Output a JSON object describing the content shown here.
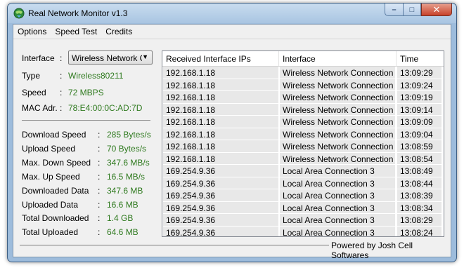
{
  "window": {
    "title": "Real Network Monitor v1.3"
  },
  "caption": {
    "minimize": "–",
    "maximize": "□",
    "close": "✕"
  },
  "menu": [
    "Options",
    "Speed Test",
    "Credits"
  ],
  "info": {
    "interface_label": "Interface",
    "interface_value": "Wireless Network Co",
    "type_label": "Type",
    "type_value": "Wireless80211",
    "speed_label": "Speed",
    "speed_value": "72 MBPS",
    "mac_label": "MAC Adr.",
    "mac_value": "78:E4:00:0C:AD:7D"
  },
  "stats": [
    {
      "label": "Download Speed",
      "value": "285 Bytes/s"
    },
    {
      "label": "Upload Speed",
      "value": "70 Bytes/s"
    },
    {
      "label": "Max. Down Speed",
      "value": "347.6 MB/s"
    },
    {
      "label": "Max. Up Speed",
      "value": "16.5 MB/s"
    },
    {
      "label": "Downloaded Data",
      "value": "347.6 MB"
    },
    {
      "label": "Uploaded Data",
      "value": "16.6 MB"
    },
    {
      "label": "Total Downloaded",
      "value": "1.4 GB"
    },
    {
      "label": "Total Uploaded",
      "value": "64.6 MB"
    }
  ],
  "table": {
    "columns": [
      "Received Interface IPs",
      "Interface",
      "Time"
    ],
    "rows": [
      [
        "192.168.1.18",
        "Wireless Network Connection",
        "13:09:29"
      ],
      [
        "192.168.1.18",
        "Wireless Network Connection",
        "13:09:24"
      ],
      [
        "192.168.1.18",
        "Wireless Network Connection",
        "13:09:19"
      ],
      [
        "192.168.1.18",
        "Wireless Network Connection",
        "13:09:14"
      ],
      [
        "192.168.1.18",
        "Wireless Network Connection",
        "13:09:09"
      ],
      [
        "192.168.1.18",
        "Wireless Network Connection",
        "13:09:04"
      ],
      [
        "192.168.1.18",
        "Wireless Network Connection",
        "13:08:59"
      ],
      [
        "192.168.1.18",
        "Wireless Network Connection",
        "13:08:54"
      ],
      [
        "169.254.9.36",
        "Local Area Connection 3",
        "13:08:49"
      ],
      [
        "169.254.9.36",
        "Local Area Connection 3",
        "13:08:44"
      ],
      [
        "169.254.9.36",
        "Local Area Connection 3",
        "13:08:39"
      ],
      [
        "169.254.9.36",
        "Local Area Connection 3",
        "13:08:34"
      ],
      [
        "169.254.9.36",
        "Local Area Connection 3",
        "13:08:29"
      ],
      [
        "169.254.9.36",
        "Local Area Connection 3",
        "13:08:24"
      ]
    ]
  },
  "footer": {
    "text": "Powered by Josh Cell Softwares"
  },
  "colors": {
    "value_green": "#2f7a1f",
    "title_bar": "#a9c5e2"
  }
}
